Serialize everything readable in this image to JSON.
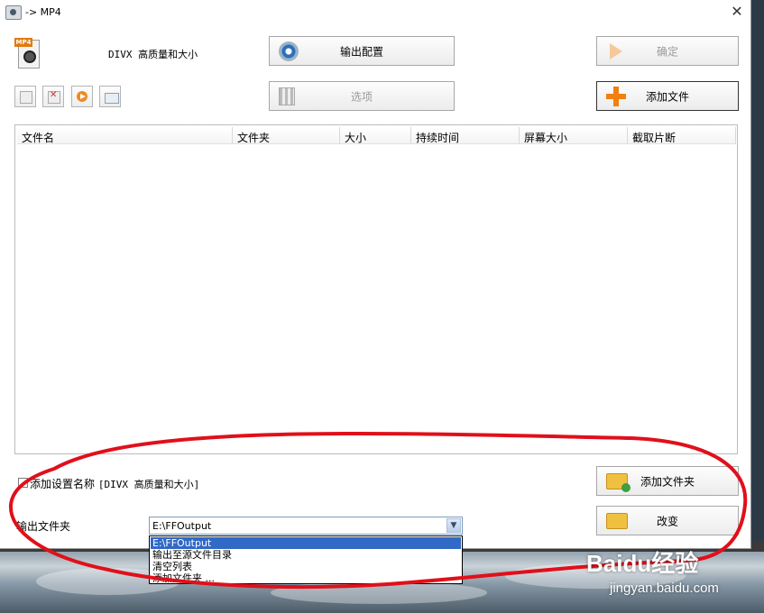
{
  "window": {
    "title": "-> MP4",
    "close_glyph": "✕"
  },
  "profile": {
    "icon": "mp4-file-icon",
    "icon_tag": "MP4",
    "name": "DIVX 高质量和大小"
  },
  "buttons": {
    "output_config": "输出配置",
    "ok": "确定",
    "options": "选项",
    "add_file": "添加文件",
    "add_folder": "添加文件夹",
    "change": "改变"
  },
  "toolbar_icons": [
    "new-doc-icon",
    "delete-doc-icon",
    "play-icon",
    "info-icon"
  ],
  "file_list": {
    "columns": [
      "文件名",
      "文件夹",
      "大小",
      "持续时间",
      "屏幕大小",
      "截取片断"
    ],
    "rows": []
  },
  "settings": {
    "add_setting_name_label": "添加设置名称",
    "add_setting_name_value": "[DIVX 高质量和大小]",
    "add_setting_name_checked": false
  },
  "output": {
    "label": "输出文件夹",
    "selected": "E:\\FFOutput",
    "options": [
      "E:\\FFOutput",
      "输出至源文件目录",
      "清空列表",
      "添加文件夹 ..."
    ]
  },
  "watermark": {
    "main": "Baidu经验",
    "sub": "jingyan.baidu.com"
  },
  "colors": {
    "annotation": "#e0101a",
    "selection": "#3169c6",
    "accent_orange": "#f08010"
  }
}
